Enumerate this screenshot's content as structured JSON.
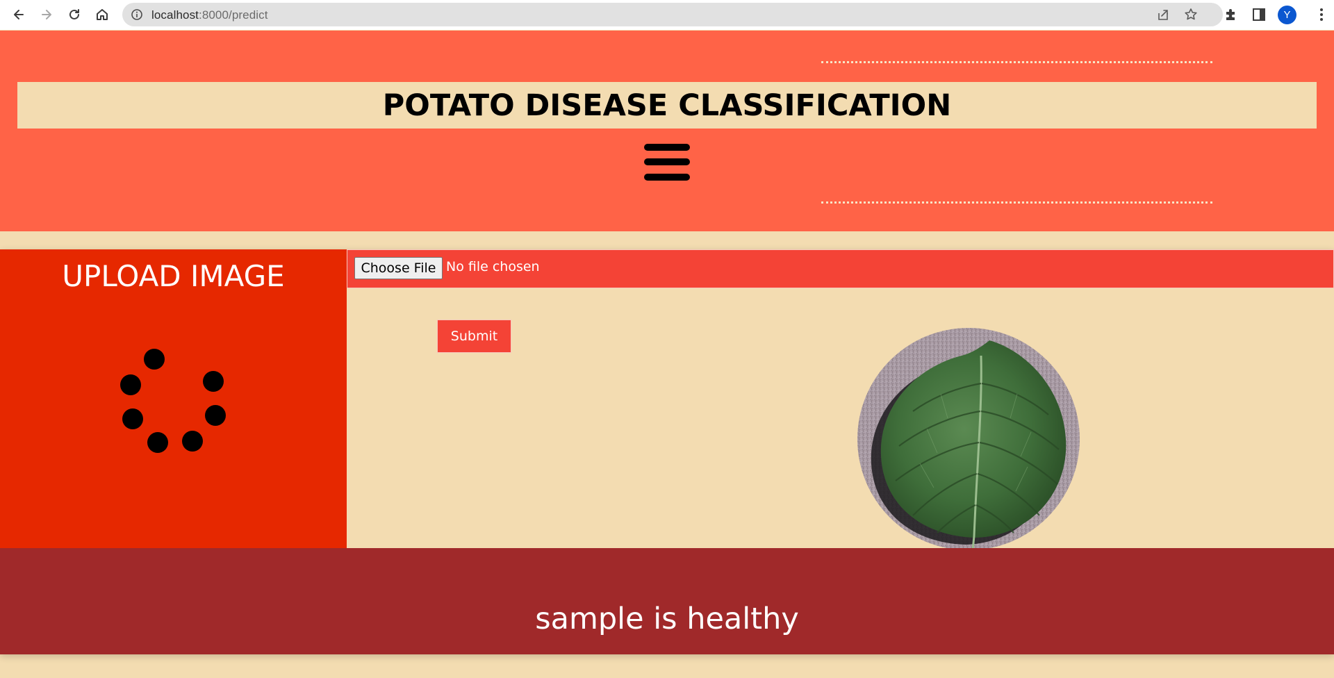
{
  "browser": {
    "url_host": "localhost",
    "url_path": ":8000/predict",
    "profile_initial": "Y",
    "icons": [
      "back-arrow-icon",
      "forward-arrow-icon",
      "reload-icon",
      "home-icon",
      "site-info-icon",
      "share-icon",
      "star-icon",
      "extensions-icon",
      "side-panel-icon",
      "more-menu-icon"
    ]
  },
  "header": {
    "title": "POTATO DISEASE CLASSIFICATION",
    "menu_icon": "hamburger-menu-icon"
  },
  "upload": {
    "title": "UPLOAD IMAGE",
    "choose_file_label": "Choose File",
    "file_status": "No file chosen",
    "submit_label": "Submit"
  },
  "result": {
    "text": "sample is healthy"
  },
  "colors": {
    "header_bg": "#ff6347",
    "page_bg": "#f3dcb1",
    "upload_panel_bg": "#e62800",
    "file_bar_bg": "#f44336",
    "result_bg": "#a0292a"
  }
}
